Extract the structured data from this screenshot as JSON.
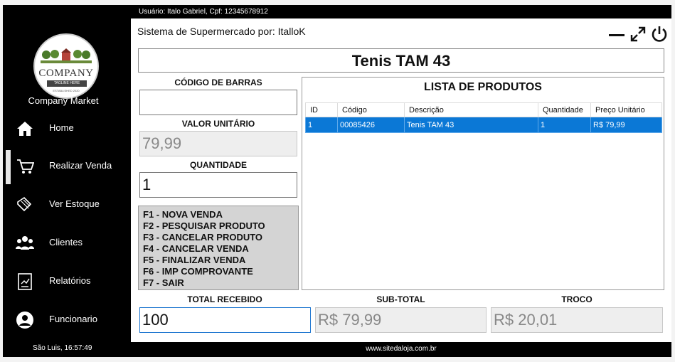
{
  "user_line": "Usuário: Italo Gabriel, Cpf: 12345678912",
  "app_title": "Sistema de Supermercado por: ItalloK",
  "logo": {
    "text": "COMPANY",
    "tagline": "TAGLINE HERE",
    "established": "ESTABLISHED 2020"
  },
  "brand_name": "Company Market",
  "nav": [
    {
      "label": "Home",
      "icon": "home-icon"
    },
    {
      "label": "Realizar Venda",
      "icon": "cart-icon",
      "active": true
    },
    {
      "label": "Ver Estoque",
      "icon": "stock-icon"
    },
    {
      "label": "Clientes",
      "icon": "users-icon"
    },
    {
      "label": "Relatórios",
      "icon": "report-icon"
    },
    {
      "label": "Funcionario",
      "icon": "user-icon"
    }
  ],
  "clock": "São Luis, 16:57:49",
  "website": "www.sitedaloja.com.br",
  "product_name": "Tenis TAM 43",
  "fields": {
    "barcode_label": "CÓDIGO DE BARRAS",
    "barcode_value": "",
    "unit_price_label": "VALOR UNITÁRIO",
    "unit_price_value": "79,99",
    "quantity_label": "QUANTIDADE",
    "quantity_value": "1"
  },
  "shortcuts": [
    "F1 - NOVA VENDA",
    "F2 - PESQUISAR PRODUTO",
    "F3 - CANCELAR PRODUTO",
    "F4 - CANCELAR VENDA",
    "F5 - FINALIZAR VENDA",
    "F6 - IMP COMPROVANTE",
    "F7 - SAIR"
  ],
  "product_list": {
    "title": "LISTA DE PRODUTOS",
    "columns": [
      "ID",
      "Código",
      "Descrição",
      "Quantidade",
      "Preço Unitário"
    ],
    "rows": [
      [
        "1",
        "00085426",
        "Tenis TAM 43",
        "1",
        "R$ 79,99"
      ]
    ]
  },
  "totals": {
    "received_label": "TOTAL RECEBIDO",
    "received_value": "100",
    "subtotal_label": "SUB-TOTAL",
    "subtotal_value": "R$ 79,99",
    "change_label": "TROCO",
    "change_value": "R$ 20,01"
  },
  "colors": {
    "selection": "#0b78d6",
    "sidebar": "#000000"
  }
}
